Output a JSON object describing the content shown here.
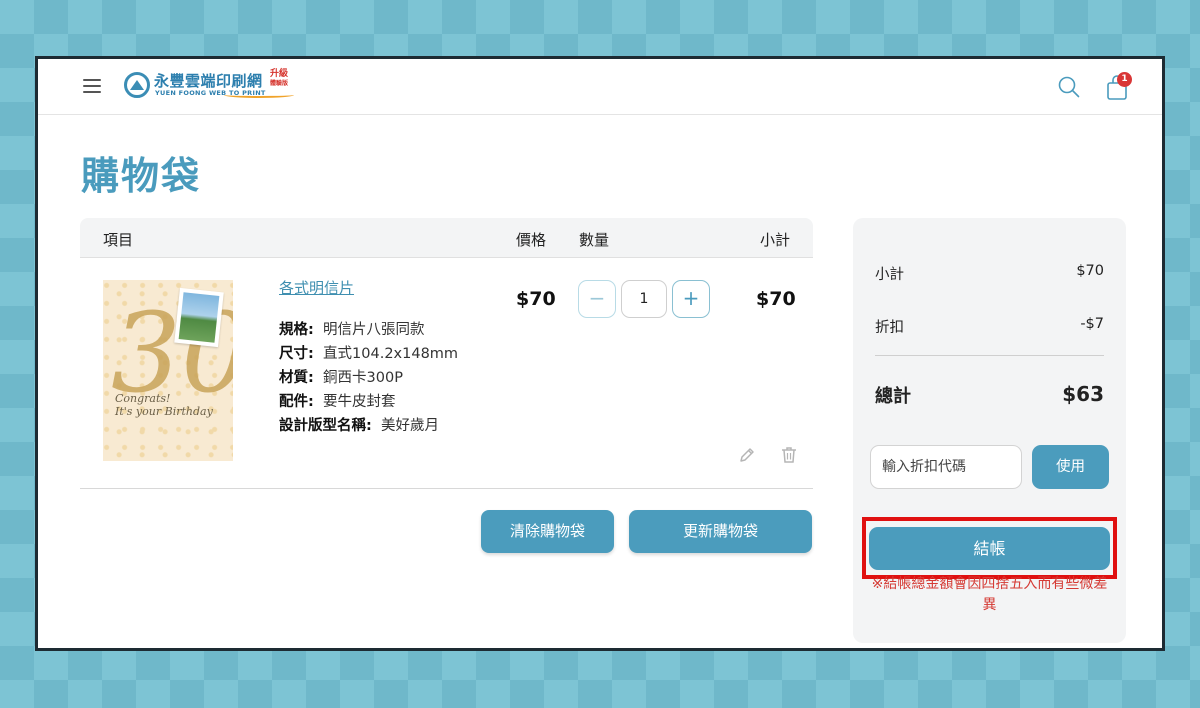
{
  "header": {
    "logo_name": "永豐雲端印刷網",
    "logo_sub": "YUEN FOONG WEB TO PRINT",
    "logo_badge_top": "升級",
    "logo_badge_bottom": "體驗版",
    "cart_count": "1"
  },
  "page": {
    "title": "購物袋"
  },
  "table": {
    "headers": {
      "item": "項目",
      "price": "價格",
      "qty": "數量",
      "subtotal": "小計"
    },
    "items": [
      {
        "name": "各式明信片",
        "thumb_script_1": "Congrats!",
        "thumb_script_2": "It's your Birthday",
        "thumb_number": "30",
        "specs": [
          {
            "label": "規格:",
            "value": "明信片八張同款"
          },
          {
            "label": "尺寸:",
            "value": "直式104.2x148mm"
          },
          {
            "label": "材質:",
            "value": "銅西卡300P"
          },
          {
            "label": "配件:",
            "value": "要牛皮封套"
          },
          {
            "label": "設計版型名稱:",
            "value": "美好歲月"
          }
        ],
        "price": "$70",
        "quantity": "1",
        "minus": "−",
        "plus": "+",
        "subtotal": "$70"
      }
    ]
  },
  "actions": {
    "clear": "清除購物袋",
    "update": "更新購物袋"
  },
  "summary": {
    "subtotal_label": "小計",
    "subtotal_value": "$70",
    "discount_label": "折扣",
    "discount_value": "-$7",
    "total_label": "總計",
    "total_value": "$63",
    "coupon_placeholder": "輸入折扣代碼",
    "apply_label": "使用",
    "checkout_label": "結帳",
    "note": "※結帳總金額會因四捨五入而有些微差異"
  },
  "colors": {
    "accent": "#4b9cbd",
    "title": "#4a9bbd",
    "highlight": "#e01010",
    "note": "#d53a34"
  },
  "icons": [
    "menu-icon",
    "search-icon",
    "shopping-bag-icon",
    "pencil-icon",
    "trash-icon"
  ]
}
